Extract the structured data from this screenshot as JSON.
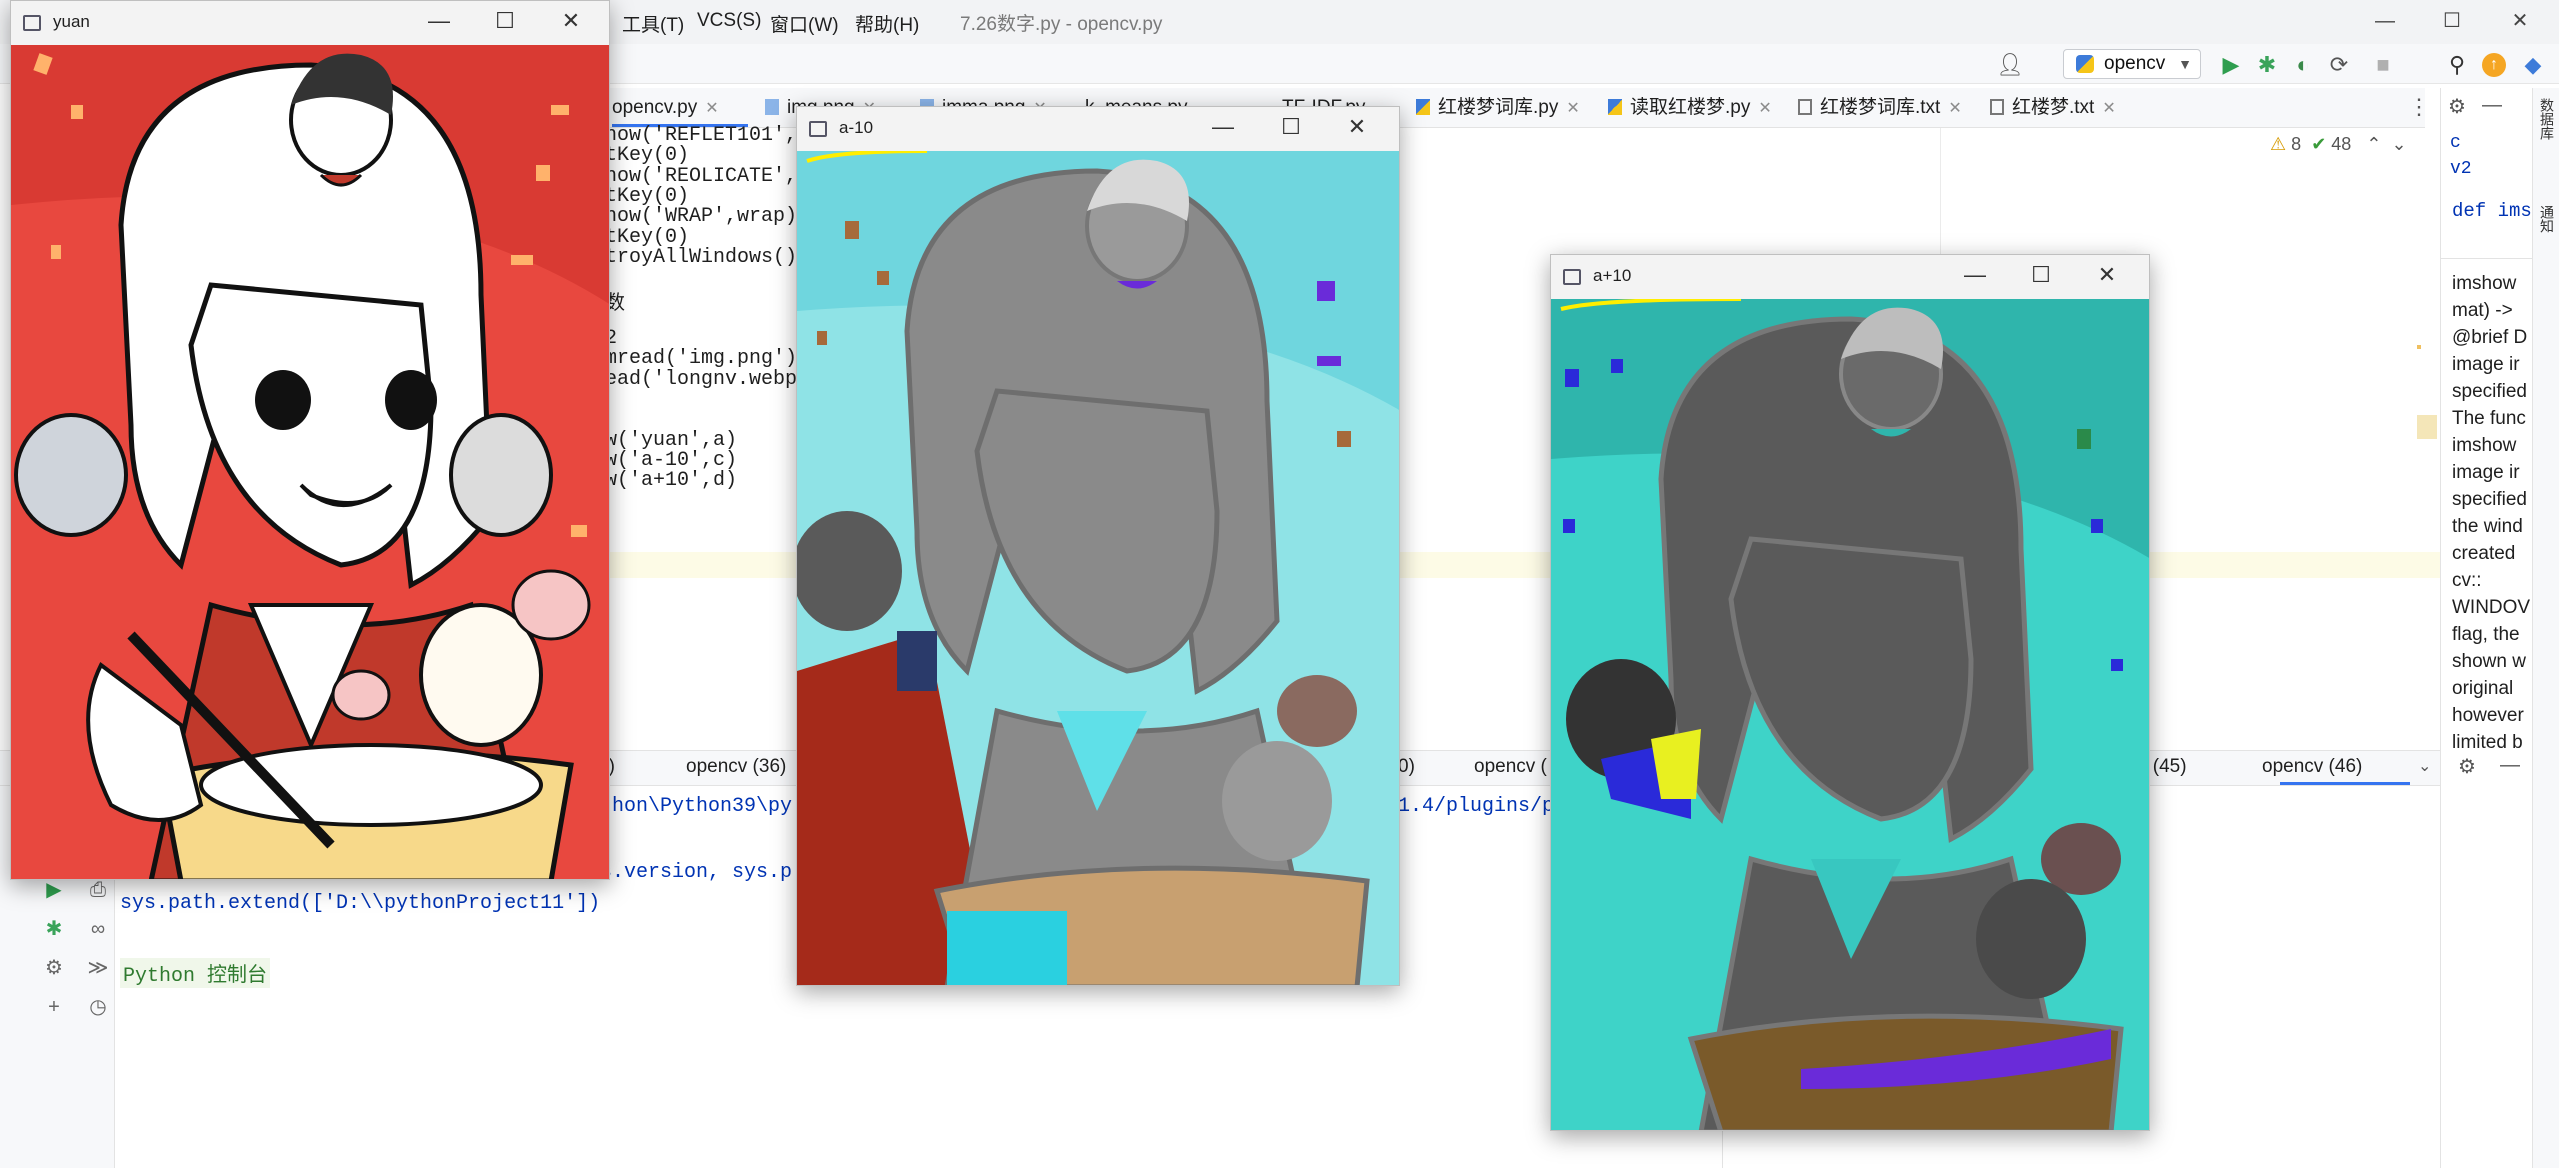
{
  "ide": {
    "menu": [
      "工具(T)",
      "VCS(S)",
      "窗口(W)",
      "帮助(H)"
    ],
    "title": "7.26数字.py - opencv.py",
    "run_config": "opencv",
    "tabs": [
      "opencv.py",
      "img.png",
      "imma.png",
      "k_means.py",
      "TF-IDF.py",
      "红楼梦词库.py",
      "读取红楼梦.py",
      "红楼梦词库.txt",
      "红楼梦.txt"
    ],
    "inspections": {
      "warnings": "8",
      "ok": "48"
    },
    "code_lines": [
      "how('REFLET101',",
      "tKey(0)",
      "how('REOLICATE',",
      "tKey(0)",
      "how('WRAP',wrap)",
      "tKey(0)",
      "troyAllWindows()",
      "",
      "数",
      "",
      "2",
      "mread('img.png')",
      "ead('longnv.webp",
      "",
      "",
      "w('yuan',a)",
      "w('a-10',c)",
      "w('a+10',d)"
    ],
    "doc": {
      "top": [
        "c",
        "v2"
      ],
      "def": "def ims",
      "body": [
        "imshow",
        "mat) ->",
        "@brief D",
        "image ir",
        "specified",
        "The func",
        "imshow",
        "image ir",
        "specified",
        "the wind",
        "created",
        "cv::",
        "WINDOV",
        " flag, the",
        "shown w",
        "original",
        "however",
        "limited b"
      ]
    },
    "right_strip": [
      "数据库",
      "通知"
    ]
  },
  "run_panel": {
    "tabs": [
      "5)",
      "opencv (36)",
      "0)",
      "opencv (",
      "v (45)",
      "opencv (46)"
    ],
    "lines": [
      "thon\\Python39\\py",
      "1.4/plugins/p",
      "s.version, sys.p",
      "sys.path.extend(['D:\\\\pythonProject11'])"
    ],
    "prompt": "Python 控制台"
  },
  "cv_windows": [
    {
      "title": "yuan",
      "variant": "original"
    },
    {
      "title": "a-10",
      "variant": "minus"
    },
    {
      "title": "a+10",
      "variant": "plus"
    }
  ],
  "window_controls": {
    "minimize": "—",
    "maximize": "☐",
    "close": "✕"
  },
  "icons": [
    "run-icon",
    "debug-icon",
    "coverage-icon",
    "profile-icon",
    "stop-icon",
    "search-icon",
    "update-icon",
    "python-icon",
    "settings-icon",
    "more-icon"
  ],
  "colors": {
    "accent": "#3574f0",
    "run_green": "#2f9e4f",
    "debug_green": "#3aa35a",
    "yuan_bg": "#e8483f",
    "a_minus_bg": "#8fe3e6",
    "a_plus_bg": "#3ed3c8",
    "gray_figure": "#8a8a8a",
    "highlighter": "#ffee00"
  }
}
